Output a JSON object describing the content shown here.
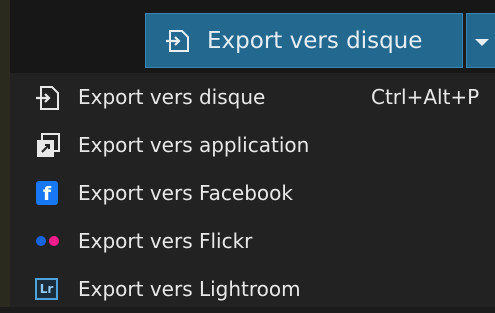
{
  "toolbar": {
    "export_button_label": "Export vers disque",
    "export_button_icon": "export-disk-icon",
    "dropdown_icon": "chevron-down-icon",
    "accent_color": "#23688f"
  },
  "menu": {
    "items": [
      {
        "label": "Export vers disque",
        "shortcut": "Ctrl+Alt+P",
        "icon": "export-disk-icon"
      },
      {
        "label": "Export vers application",
        "shortcut": "",
        "icon": "export-application-icon"
      },
      {
        "label": "Export vers Facebook",
        "shortcut": "",
        "icon": "facebook-icon"
      },
      {
        "label": "Export vers Flickr",
        "shortcut": "",
        "icon": "flickr-icon"
      },
      {
        "label": "Export vers Lightroom",
        "shortcut": "",
        "icon": "lightroom-icon"
      }
    ]
  },
  "icons": {
    "facebook_glyph": "f",
    "lightroom_glyph": "Lr"
  }
}
